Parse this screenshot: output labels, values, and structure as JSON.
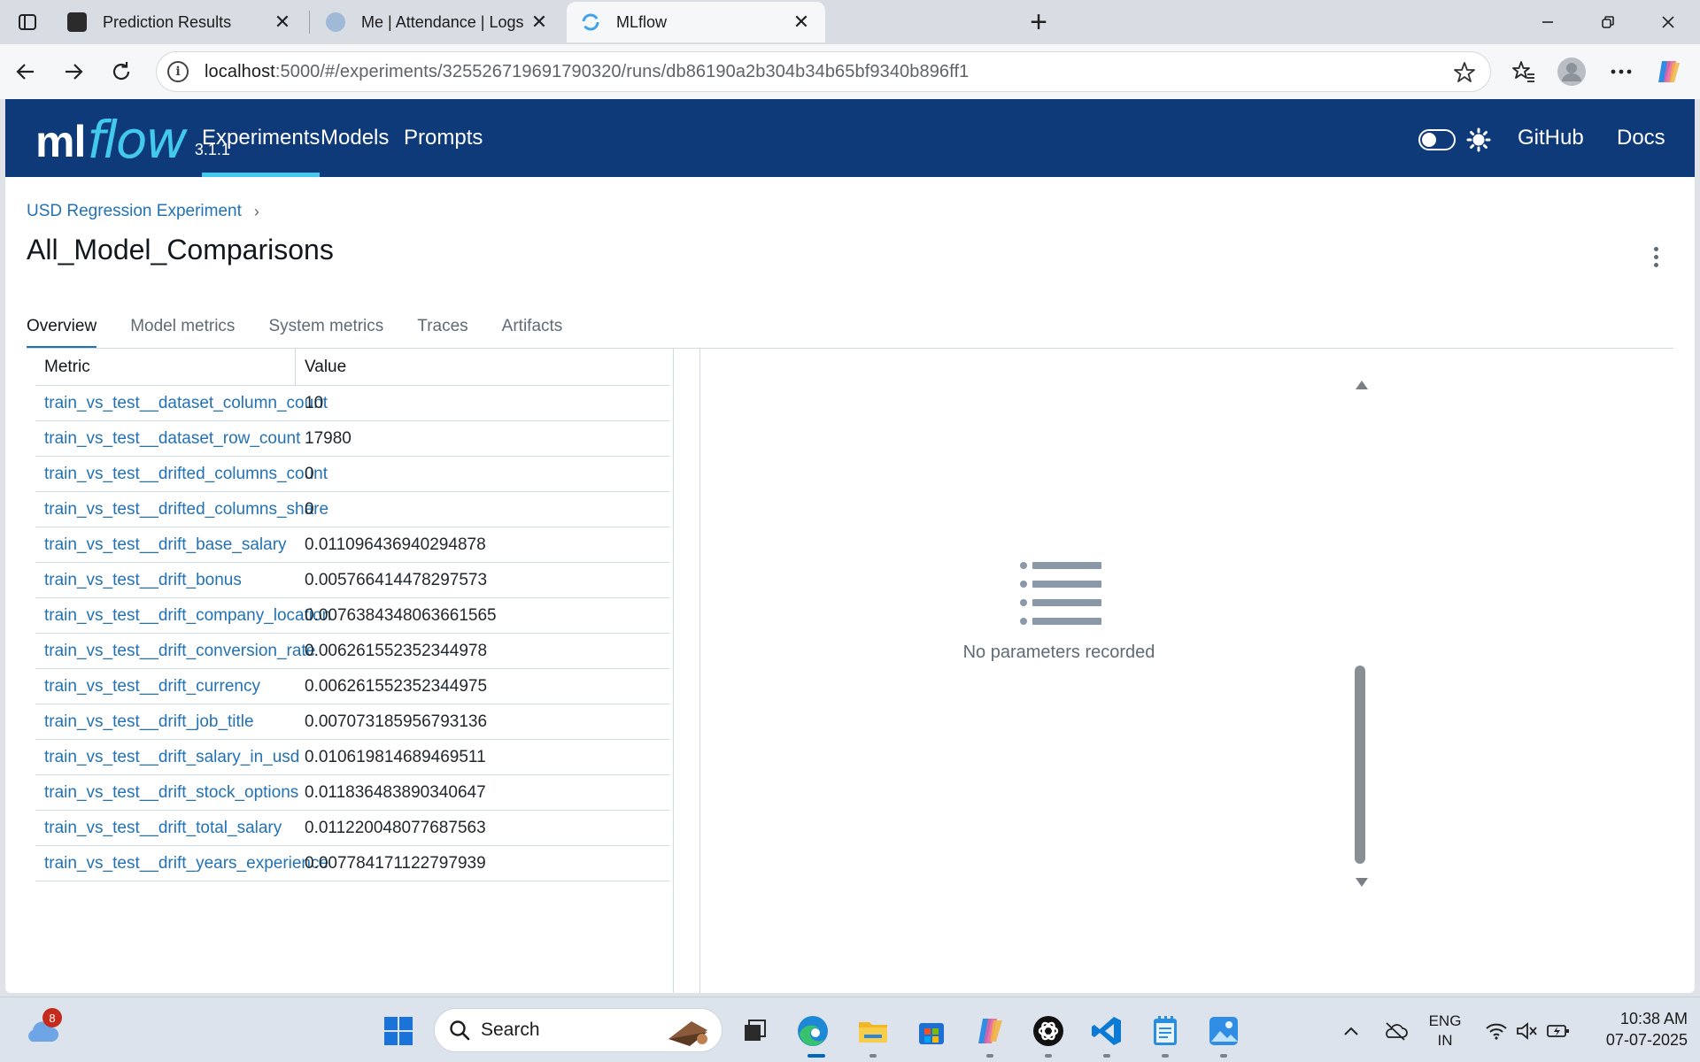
{
  "browser": {
    "tabs": [
      {
        "title": "Prediction Results"
      },
      {
        "title": "Me | Attendance | Logs"
      },
      {
        "title": "MLflow"
      }
    ],
    "url_host": "localhost",
    "url_rest": ":5000/#/experiments/325526719691790320/runs/db86190a2b304b34b65bf9340b896ff1"
  },
  "header": {
    "logo_ml": "ml",
    "logo_flow": "flow",
    "version": "3.1.1",
    "nav": [
      "Experiments",
      "Models",
      "Prompts"
    ],
    "links": [
      "GitHub",
      "Docs"
    ]
  },
  "breadcrumb": "USD Regression Experiment",
  "page_title": "All_Model_Comparisons",
  "tabs": [
    "Overview",
    "Model metrics",
    "System metrics",
    "Traces",
    "Artifacts"
  ],
  "metrics": {
    "headers": [
      "Metric",
      "Value"
    ],
    "rows": [
      [
        "train_vs_test__dataset_column_count",
        "10"
      ],
      [
        "train_vs_test__dataset_row_count",
        "17980"
      ],
      [
        "train_vs_test__drifted_columns_count",
        "0"
      ],
      [
        "train_vs_test__drifted_columns_share",
        "0"
      ],
      [
        "train_vs_test__drift_base_salary",
        "0.011096436940294878"
      ],
      [
        "train_vs_test__drift_bonus",
        "0.005766414478297573"
      ],
      [
        "train_vs_test__drift_company_location",
        "0.0076384348063661565"
      ],
      [
        "train_vs_test__drift_conversion_rate",
        "0.006261552352344978"
      ],
      [
        "train_vs_test__drift_currency",
        "0.006261552352344975"
      ],
      [
        "train_vs_test__drift_job_title",
        "0.007073185956793136"
      ],
      [
        "train_vs_test__drift_salary_in_usd",
        "0.010619814689469511"
      ],
      [
        "train_vs_test__drift_stock_options",
        "0.011836483890340647"
      ],
      [
        "train_vs_test__drift_total_salary",
        "0.011220048077687563"
      ],
      [
        "train_vs_test__drift_years_experience",
        "0.007784171122797939"
      ]
    ]
  },
  "params_empty": "No parameters recorded",
  "taskbar": {
    "weather_badge": "8",
    "search_label": "Search",
    "lang_1": "ENG",
    "lang_2": "IN",
    "time": "10:38 AM",
    "date": "07-07-2025"
  },
  "colors": {
    "header_bg": "#0e3a7a",
    "accent": "#43c9ed",
    "link": "#2272b4"
  }
}
